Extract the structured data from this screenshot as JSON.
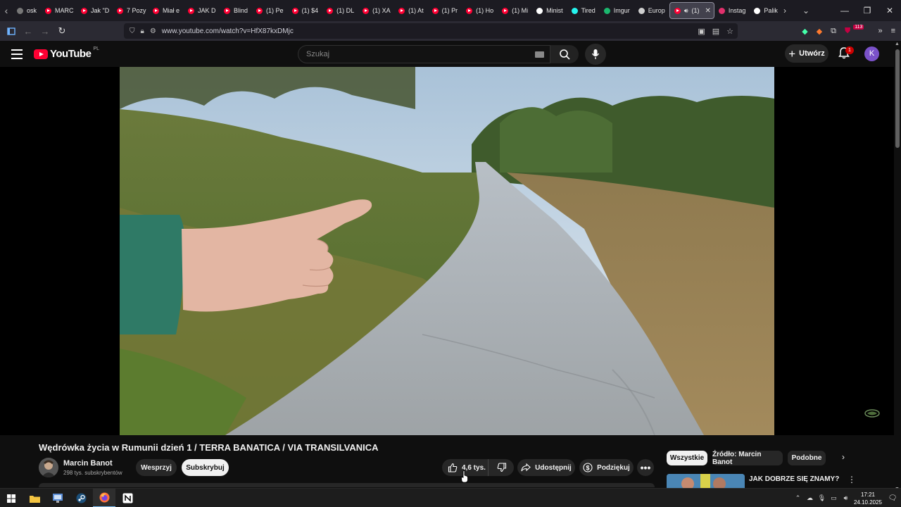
{
  "browser": {
    "tabs": [
      {
        "label": "osk",
        "icon": "generic"
      },
      {
        "label": "MARC",
        "icon": "youtube"
      },
      {
        "label": "Jak \"D",
        "icon": "youtube"
      },
      {
        "label": "7 Pozy",
        "icon": "youtube"
      },
      {
        "label": "Miał e",
        "icon": "youtube"
      },
      {
        "label": "JAK D",
        "icon": "youtube"
      },
      {
        "label": "Blind",
        "icon": "youtube"
      },
      {
        "label": "(1) Pe",
        "icon": "youtube"
      },
      {
        "label": "(1) $4",
        "icon": "youtube"
      },
      {
        "label": "(1) DL",
        "icon": "youtube"
      },
      {
        "label": "(1) XA",
        "icon": "youtube"
      },
      {
        "label": "(1) At",
        "icon": "youtube"
      },
      {
        "label": "(1) Pr",
        "icon": "youtube"
      },
      {
        "label": "(1) Ho",
        "icon": "youtube"
      },
      {
        "label": "(1) Mi",
        "icon": "youtube"
      },
      {
        "label": "Minist",
        "icon": "x"
      },
      {
        "label": "Tired",
        "icon": "tiktok"
      },
      {
        "label": "Imgur",
        "icon": "imgur"
      },
      {
        "label": "Europ",
        "icon": "globe"
      },
      {
        "label": "(1)",
        "icon": "youtube",
        "active": true
      },
      {
        "label": "Instag",
        "icon": "instagram"
      },
      {
        "label": "Palik",
        "icon": "x"
      }
    ],
    "url": "www.youtube.com/watch?v=HfX87kxDMjc",
    "extension_badge": "113"
  },
  "youtube": {
    "logo_text": "YouTube",
    "country_code": "PL",
    "search_placeholder": "Szukaj",
    "create_label": "Utwórz",
    "notification_count": "1",
    "avatar_letter": "K",
    "accent": "#ff0033"
  },
  "video": {
    "title": "Wędrówka życia w Rumunii dzień 1 / TERRA BANATICA / VIA TRANSILVANICA",
    "channel_name": "Marcin Banot",
    "subscribers": "298 tys. subskrybentów",
    "support_label": "Wesprzyj",
    "subscribe_label": "Subskrybuj",
    "likes": "4,6 tys.",
    "share_label": "Udostępnij",
    "thanks_label": "Podziękuj"
  },
  "sidebar": {
    "chips": [
      "Wszystkie",
      "Źródło: Marcin Banot",
      "Podobne"
    ],
    "recommended": {
      "title": "JAK DOBRZE SIĘ ZNAMY?"
    }
  },
  "taskbar": {
    "time": "17:21",
    "date": "24.10.2025"
  }
}
